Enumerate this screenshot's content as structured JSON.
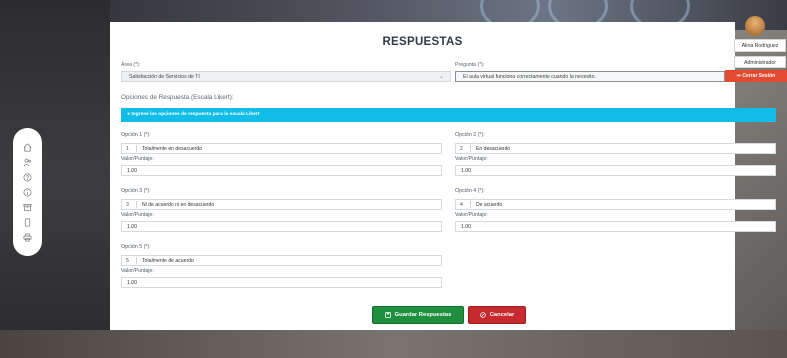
{
  "page": {
    "title": "RESPUESTAS"
  },
  "user": {
    "name": "Alina Rodriguez",
    "role": "Administrador",
    "logout_label": "Cerrar Sesión"
  },
  "form": {
    "area_label": "Área (*):",
    "area_value": "Satisfacción de Servicios de TI",
    "question_label": "Pregunta (*):",
    "question_value": "El aula virtual funciona correctamente cuando la necesito.",
    "options_title": "Opciones de Respuesta (Escala Likert):",
    "info_text": "Ingrese las opciones de respuesta para la escala Likert",
    "options": [
      {
        "label": "Opción 1 (*):",
        "num": "1",
        "text": "Totalmente en desacuerdo",
        "score_label": "Valor/Puntaje:",
        "score": "1.00"
      },
      {
        "label": "Opción 2 (*):",
        "num": "2",
        "text": "En desacuerdo",
        "score_label": "Valor/Puntaje:",
        "score": "1.00"
      },
      {
        "label": "Opción 3 (*):",
        "num": "3",
        "text": "Ni de acuerdo ni en desacuerdo",
        "score_label": "Valor/Puntaje:",
        "score": "1.00"
      },
      {
        "label": "Opción 4 (*):",
        "num": "4",
        "text": "De acuerdo",
        "score_label": "Valor/Puntaje:",
        "score": "1.00"
      },
      {
        "label": "Opción 5 (*):",
        "num": "5",
        "text": "Totalmente de acuerdo",
        "score_label": "Valor/Puntaje:",
        "score": "1.00"
      }
    ],
    "save_label": "Guardar Respuestas",
    "cancel_label": "Cancelar"
  },
  "sidebar": {
    "icons": [
      "home-icon",
      "users-icon",
      "help-icon",
      "info-icon",
      "archive-icon",
      "mobile-icon",
      "print-icon"
    ]
  },
  "colors": {
    "info_bar": "#11bde8",
    "save": "#1e8f3e",
    "cancel": "#c8292f",
    "logout": "#e24b2f"
  }
}
